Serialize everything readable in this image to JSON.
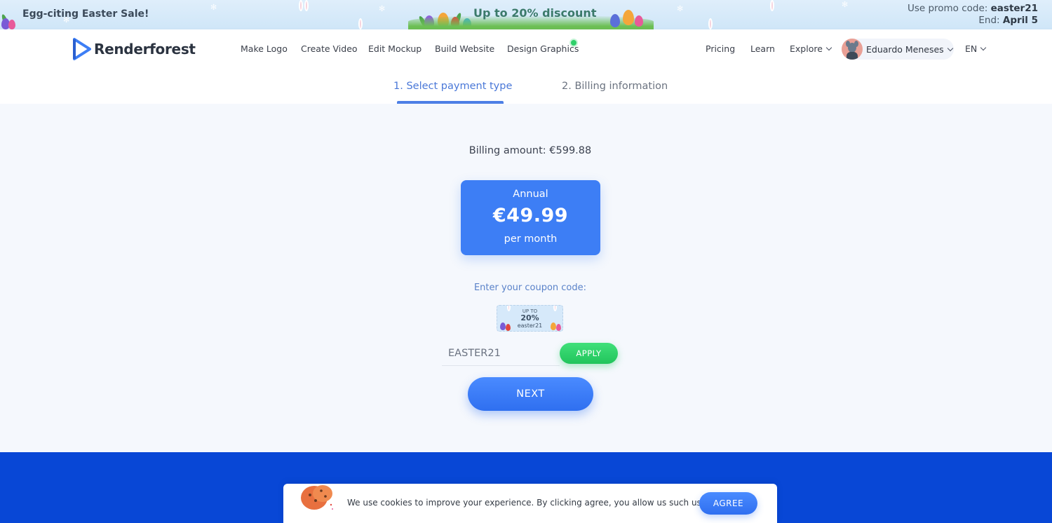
{
  "banner": {
    "left_text": "Egg-citing Easter Sale!",
    "center_text": "Up to 20% discount",
    "promo_prefix": "Use promo code: ",
    "promo_code": "easter21",
    "end_prefix": "End: ",
    "end_date": "April 5"
  },
  "header": {
    "logo_text": "Renderforest",
    "nav_left": [
      "Make Logo",
      "Create Video",
      "Edit Mockup",
      "Build Website",
      "Design Graphics"
    ],
    "nav_right": {
      "pricing": "Pricing",
      "learn": "Learn",
      "explore": "Explore"
    },
    "user_name": "Eduardo Meneses",
    "language": "EN"
  },
  "steps": {
    "step1": "1. Select payment type",
    "step2": "2. Billing information"
  },
  "billing": {
    "amount_label": "Billing amount: €599.88"
  },
  "plan": {
    "label": "Annual",
    "price": "€49.99",
    "unit": "per month"
  },
  "coupon": {
    "label": "Enter your coupon code:",
    "ticket_top": "UP TO",
    "ticket_pct": "20%",
    "ticket_code": "easter21",
    "input_value": "EASTER21",
    "apply_label": "APPLY"
  },
  "actions": {
    "next_label": "NEXT"
  },
  "cookie": {
    "text": "We use cookies to improve your experience. By clicking agree, you allow us such use.",
    "agree_label": "AGREE"
  },
  "colors": {
    "primary_blue": "#3d7ef5",
    "footer_blue": "#0847d6",
    "apply_green": "#22c45c",
    "step_active": "#4a78d8"
  }
}
